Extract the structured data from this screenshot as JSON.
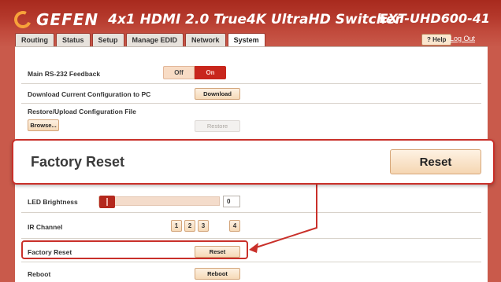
{
  "header": {
    "brand": "GEFEN",
    "product_title": "4x1 HDMI 2.0 True4K UltraHD Switcher",
    "model": "EXT-UHD600-41"
  },
  "tabs": [
    {
      "label": "Routing"
    },
    {
      "label": "Status"
    },
    {
      "label": "Setup"
    },
    {
      "label": "Manage EDID"
    },
    {
      "label": "Network"
    },
    {
      "label": "System",
      "active": true
    }
  ],
  "toolbar": {
    "help_label": "? Help",
    "logout_label": "Log Out"
  },
  "settings": {
    "rs232": {
      "label": "Main RS-232 Feedback",
      "off_label": "Off",
      "on_label": "On",
      "selected": "On"
    },
    "download": {
      "label": "Download Current Configuration to PC",
      "button": "Download"
    },
    "restore": {
      "label": "Restore/Upload Configuration File",
      "browse_button": "Browse...",
      "restore_button": "Restore"
    },
    "led": {
      "label": "LED Brightness",
      "value": "0",
      "level": 0
    },
    "ir": {
      "label": "IR Channel",
      "options": [
        "1",
        "2",
        "3",
        "4"
      ]
    },
    "factory_reset": {
      "label": "Factory Reset",
      "button": "Reset"
    },
    "reboot": {
      "label": "Reboot",
      "button": "Reboot"
    }
  },
  "callout": {
    "label": "Factory Reset",
    "button": "Reset"
  },
  "colors": {
    "header_red": "#b3372a",
    "accent_red": "#c9302a",
    "logo_orange": "#f7a23a",
    "button_peach": "#f6d9b7"
  }
}
